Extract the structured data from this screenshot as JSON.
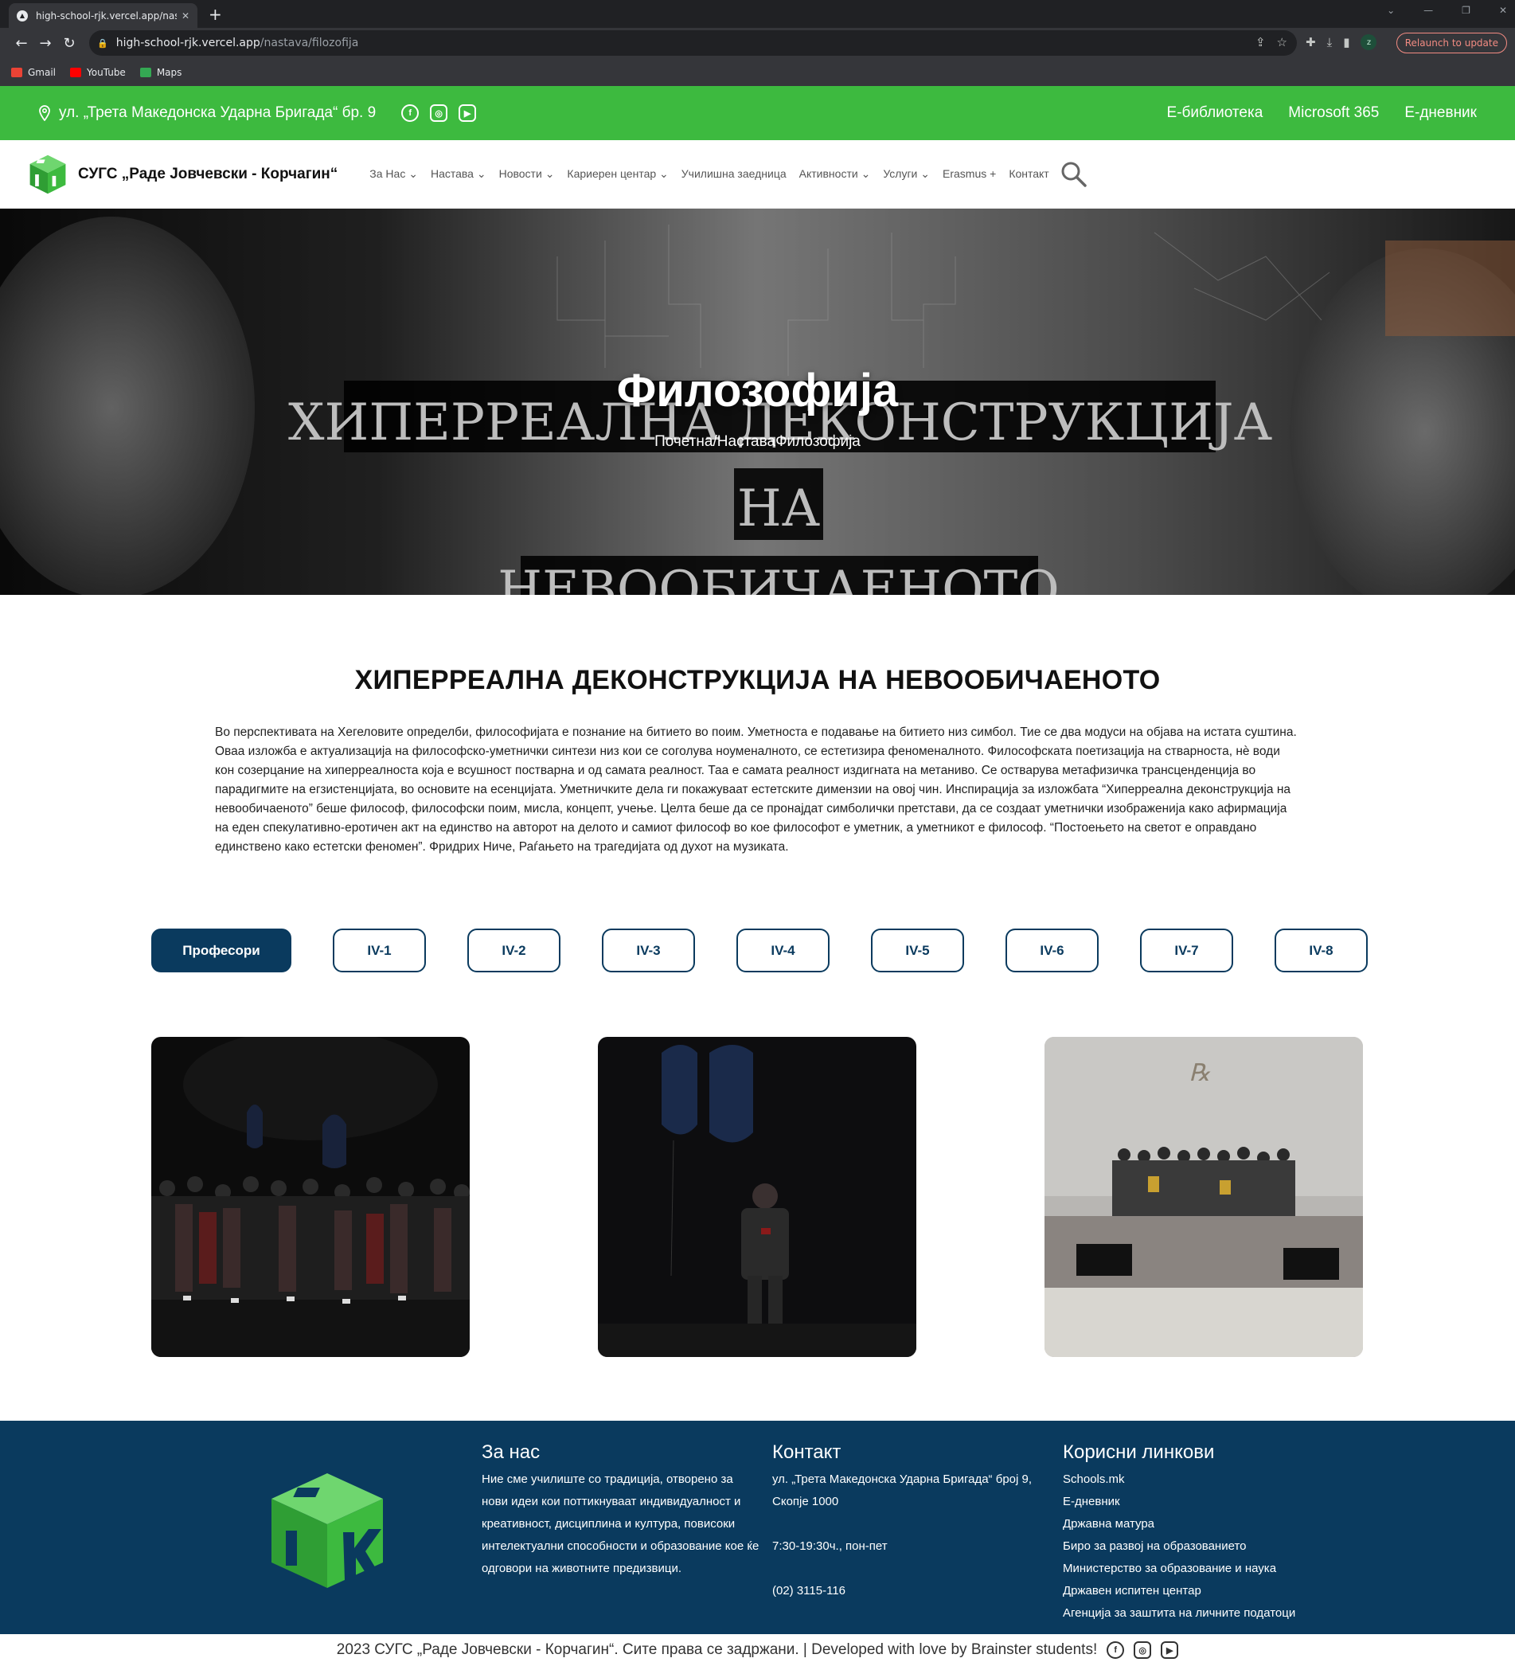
{
  "browser": {
    "tab_title": "high-school-rjk.vercel.app/nasta",
    "url_host": "high-school-rjk.vercel.app",
    "url_path": "/nastava/filozofija",
    "relaunch_label": "Relaunch to update",
    "profile_initial": "z",
    "bookmarks": [
      {
        "label": "Gmail",
        "color": "#ea4335"
      },
      {
        "label": "YouTube",
        "color": "#ff0000"
      },
      {
        "label": "Maps",
        "color": "#34a853"
      }
    ]
  },
  "topbar": {
    "address": "ул. „Трета Македонска Ударна Бригада“ бр. 9",
    "links": [
      "Е-библиотека",
      "Microsoft 365",
      "Е-дневник"
    ],
    "bg_color": "#3dba3f"
  },
  "nav": {
    "brand": "СУГС „Раде Јовчевски - Корчагин“",
    "menu": [
      "За Нас",
      "Настава",
      "Новости",
      "Кариерен центар",
      "Училишна заедница",
      "Активности",
      "Услуги",
      "Erasmus +",
      "Контакт"
    ]
  },
  "hero": {
    "title": "Филозофија",
    "breadcrumb": "Почетна/НаставаФилозофија",
    "poster_line1": "ХИПЕРРЕАЛНА ДЕКОНСТРУКЦИЈА",
    "poster_line2": "НА",
    "poster_line3": "НЕВООБИЧАЕНОТО"
  },
  "article": {
    "heading": "ХИПЕРРЕАЛНА ДЕКОНСТРУКЦИЈА НА НЕВООБИЧАЕНОТО",
    "body": "Во перспективата на Хегеловите определби, философијата е познание на битието во поим. Уметноста е подавање на битието низ симбол. Тие се два модуси на објава на истата суштина. Оваа изложба е актуализација на философско-уметнички синтези низ кои се соголува ноуменалното, се естетизира феноменалното. Философската поетизација на стварноста, нѐ води кон созерцание на хиперреалноста која е всушност постварна и од самата реалност. Таа е самата реалност издигната на метаниво. Се остварува метафизичка трансценденција во парадигмите на егзистенцијата, во основите на есенцијата. Уметничките дела ги покажуваат естетските димензии на овој чин. Инспирација за изложбата “Хиперреална деконструкција на невообичаеното” беше философ, философски поим, мисла, концепт, учење. Целта беше да се пронајдат симболички претстави, да се создаат уметнички изображенија како афирмација на еден спекулативно-еротичен акт на единство на авторот на делото и самиот философ во кое философот е уметник, а уметникот е философ. “Постоењето на светот е оправдано единствено како естетски феномен”. Фридрих Ниче, Раѓањето на трагедијата од духот на музиката."
  },
  "tabs": {
    "active": "Професори",
    "items": [
      "Професори",
      "IV-1",
      "IV-2",
      "IV-3",
      "IV-4",
      "IV-5",
      "IV-6",
      "IV-7",
      "IV-8"
    ]
  },
  "footer": {
    "about_title": "За нас",
    "about_text": "Ние сме училиште со традиција, отворено за нови идеи кои поттикнуваат индивидуалност и креативност, дисциплина и култура, повисоки интелектуални способности и образование кое ќе одговори на животните предизвици.",
    "contact_title": "Контакт",
    "contact_address": "ул. „Трета Македонска Ударна Бригада“ број 9, Скопје 1000",
    "contact_hours": "7:30-19:30ч., пон-пет",
    "contact_phone": "(02) 3115-116",
    "links_title": "Корисни линкови",
    "links": [
      "Schools.mk",
      "Е-дневник",
      "Државна матура",
      "Биро за развој на образованието",
      "Министерство за образование и наука",
      "Државен испитен центар",
      "Агенција за заштита на личните податоци"
    ],
    "copyright": "2023 СУГС „Раде Јовчевски - Корчагин“. Сите права се задржани. | Developed with love by Brainster students!",
    "bg_color": "#0a3a5e"
  }
}
